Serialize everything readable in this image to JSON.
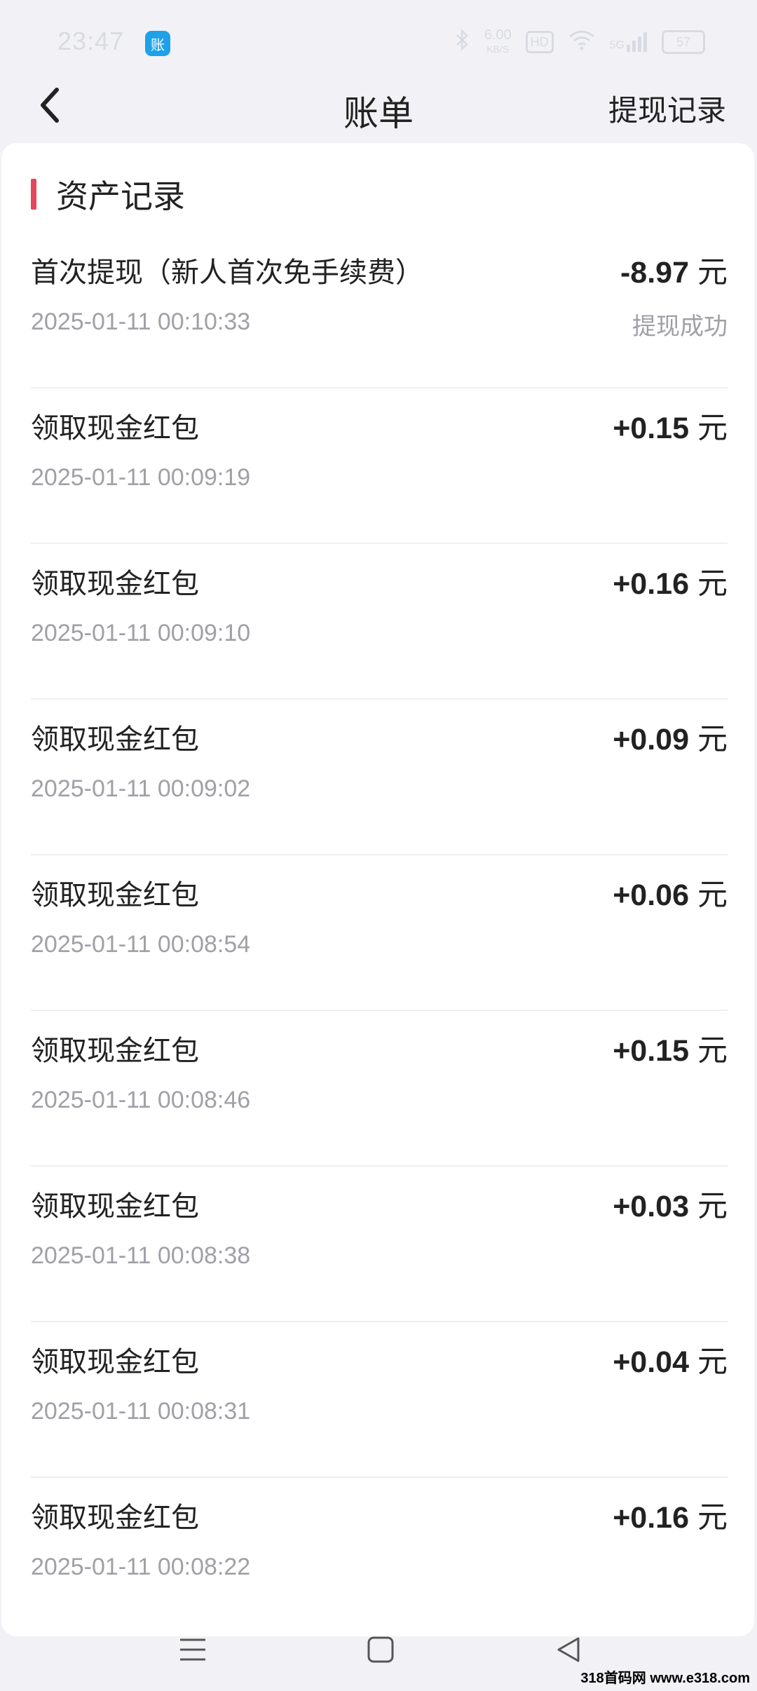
{
  "status_bar": {
    "time": "23:47",
    "app_badge": "账",
    "net_speed": "6.00",
    "net_unit": "KB/S",
    "hd_badge": "HD",
    "signal": "5G",
    "battery": "57"
  },
  "header": {
    "title": "账单",
    "right_link": "提现记录"
  },
  "section": {
    "title": "资产记录"
  },
  "records": [
    {
      "title": "首次提现（新人首次免手续费）",
      "amount": "-8.97",
      "unit": "元",
      "time": "2025-01-11 00:10:33",
      "status": "提现成功"
    },
    {
      "title": "领取现金红包",
      "amount": "+0.15",
      "unit": "元",
      "time": "2025-01-11 00:09:19",
      "status": ""
    },
    {
      "title": "领取现金红包",
      "amount": "+0.16",
      "unit": "元",
      "time": "2025-01-11 00:09:10",
      "status": ""
    },
    {
      "title": "领取现金红包",
      "amount": "+0.09",
      "unit": "元",
      "time": "2025-01-11 00:09:02",
      "status": ""
    },
    {
      "title": "领取现金红包",
      "amount": "+0.06",
      "unit": "元",
      "time": "2025-01-11 00:08:54",
      "status": ""
    },
    {
      "title": "领取现金红包",
      "amount": "+0.15",
      "unit": "元",
      "time": "2025-01-11 00:08:46",
      "status": ""
    },
    {
      "title": "领取现金红包",
      "amount": "+0.03",
      "unit": "元",
      "time": "2025-01-11 00:08:38",
      "status": ""
    },
    {
      "title": "领取现金红包",
      "amount": "+0.04",
      "unit": "元",
      "time": "2025-01-11 00:08:31",
      "status": ""
    },
    {
      "title": "领取现金红包",
      "amount": "+0.16",
      "unit": "元",
      "time": "2025-01-11 00:08:22",
      "status": ""
    }
  ],
  "watermark": "318首码网 www.e318.com",
  "icons": {
    "back": "chevron-left-icon",
    "menu": "menu-icon",
    "home": "home-icon",
    "back_nav": "triangle-back-icon"
  },
  "colors": {
    "accent": "#e5475e",
    "page_bg": "#f2f2f6",
    "muted_text": "#a0a0a6"
  }
}
